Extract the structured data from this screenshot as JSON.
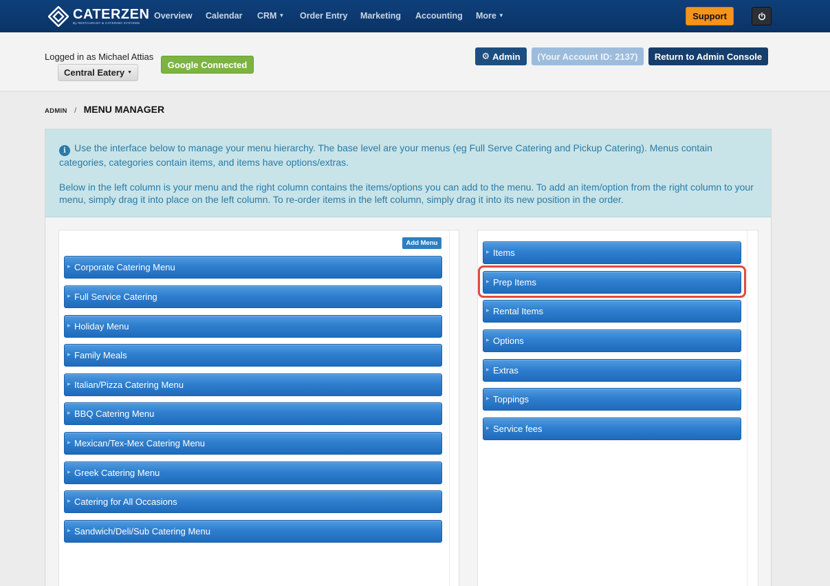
{
  "brand": {
    "name": "CATERZEN",
    "tagline": "By RESTAURANT & CATERING SYSTEMS"
  },
  "nav": {
    "items": [
      {
        "label": "Overview"
      },
      {
        "label": "Calendar"
      },
      {
        "label": "CRM",
        "dropdown": true
      },
      {
        "label": "Order Entry"
      },
      {
        "label": "Marketing"
      },
      {
        "label": "Accounting"
      },
      {
        "label": "More",
        "dropdown": true
      }
    ],
    "support_label": "Support",
    "power_icon": "power-icon"
  },
  "account": {
    "logged_in_text": "Logged in as Michael Attias",
    "location": "Central Eatery",
    "google_label": "Google Connected",
    "admin_label": "Admin",
    "account_id_label": "(Your Account ID: 2137)",
    "return_label": "Return to Admin Console"
  },
  "breadcrumb": {
    "root": "ADMIN",
    "separator": "/",
    "current": "MENU MANAGER"
  },
  "info": {
    "paragraph1": "Use the interface below to manage your menu hierarchy. The base level are your menus (eg Full Serve Catering and Pickup Catering). Menus contain categories, categories contain items, and items have options/extras.",
    "paragraph2": "Below in the left column is your menu and the right column contains the items/options you can add to the menu. To add an item/option from the right column to your menu, simply drag it into place on the left column. To re-order items in the left column, simply drag it into its new position in the order."
  },
  "menus": {
    "add_label": "Add Menu",
    "items": [
      "Corporate Catering Menu",
      "Full Service Catering",
      "Holiday Menu",
      "Family Meals",
      "Italian/Pizza Catering Menu",
      "BBQ Catering Menu",
      "Mexican/Tex-Mex Catering Menu",
      "Greek Catering Menu",
      "Catering for All Occasions",
      "Sandwich/Deli/Sub Catering Menu"
    ]
  },
  "library": {
    "items": [
      "Items",
      "Prep Items",
      "Rental Items",
      "Options",
      "Extras",
      "Toppings",
      "Service fees"
    ],
    "highlighted": "Prep Items"
  },
  "colors": {
    "navbar": "#0f3f7a",
    "support": "#f5941d",
    "google": "#7cb342",
    "bar": "#2f7fce",
    "highlight": "#e04b3c",
    "info_bg": "#c8e4e8",
    "info_text": "#2a7aa6"
  }
}
